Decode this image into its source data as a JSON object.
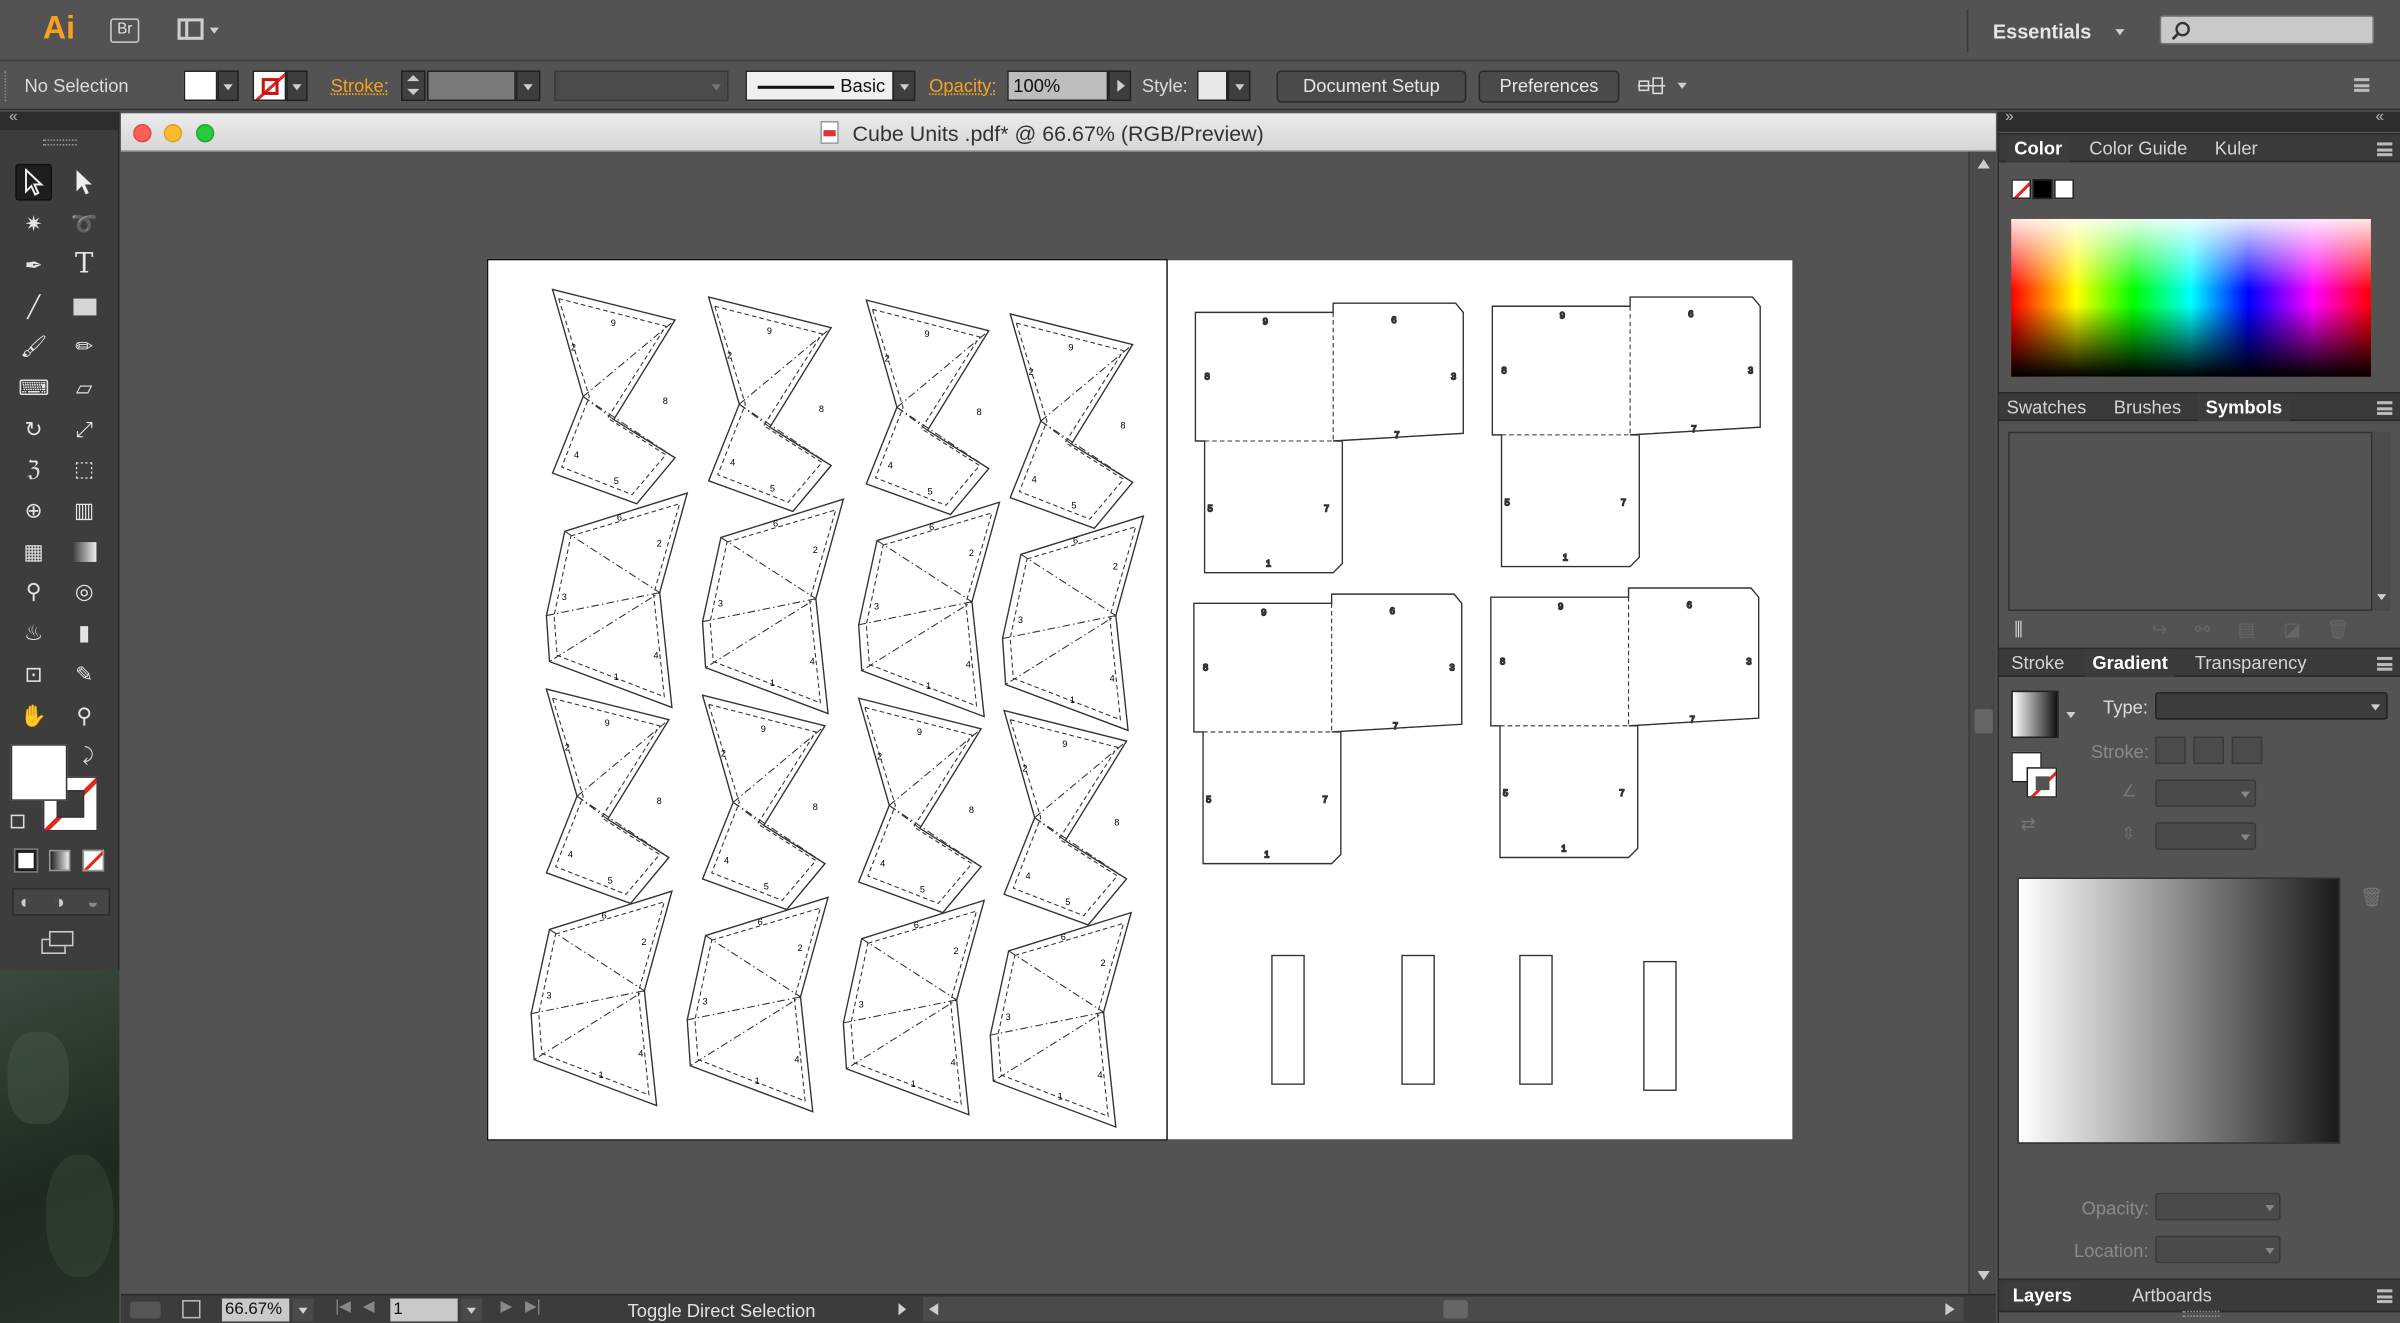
{
  "app": {
    "logo": "Ai",
    "bridge": "Br",
    "workspace": "Essentials"
  },
  "control_bar": {
    "selection_status": "No Selection",
    "stroke_label": "Stroke:",
    "brush_style": "Basic",
    "opacity_label": "Opacity:",
    "opacity_value": "100%",
    "style_label": "Style:",
    "document_setup": "Document Setup",
    "preferences": "Preferences"
  },
  "document": {
    "title": "Cube Units .pdf* @ 66.67% (RGB/Preview)"
  },
  "status_bar": {
    "zoom": "66.67%",
    "artboard": "1",
    "info": "Toggle Direct Selection"
  },
  "panels": {
    "color_tabs": [
      "Color",
      "Color Guide",
      "Kuler"
    ],
    "symbols_tabs": [
      "Swatches",
      "Brushes",
      "Symbols"
    ],
    "gradient_tabs": [
      "Stroke",
      "Gradient",
      "Transparency"
    ],
    "gradient_type_label": "Type:",
    "gradient_stroke_label": "Stroke:",
    "gradient_opacity_label": "Opacity:",
    "gradient_location_label": "Location:",
    "layers_tabs": [
      "Layers",
      "Artboards"
    ]
  },
  "artwork": {
    "octa_numbers": [
      "9",
      "2",
      "8",
      "4",
      "5",
      "6",
      "2",
      "3",
      "4",
      "1"
    ],
    "cube_numbers": [
      "9",
      "6",
      "8",
      "3",
      "7",
      "5",
      "7",
      "1"
    ]
  },
  "colors": {
    "accent_orange": "#f7a021",
    "panel": "#535353",
    "toolbar": "#2d2d2d",
    "artboard": "#ffffff"
  }
}
